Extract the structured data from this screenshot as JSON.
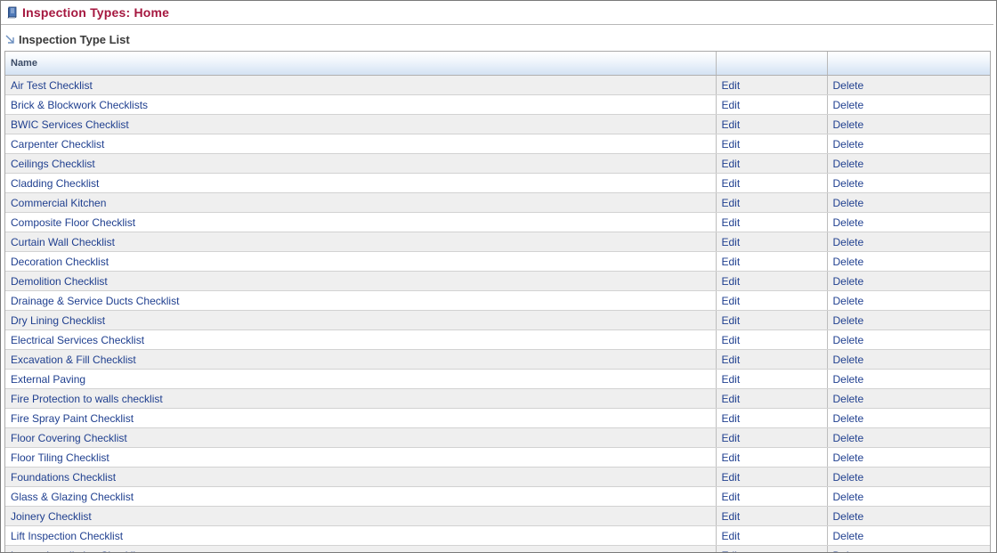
{
  "header": {
    "title": "Inspection Types: Home"
  },
  "section": {
    "title": "Inspection Type List"
  },
  "table": {
    "columns": [
      "Name",
      "",
      ""
    ],
    "edit_label": "Edit",
    "delete_label": "Delete",
    "rows": [
      "Air Test Checklist",
      "Brick & Blockwork Checklists",
      "BWIC Services Checklist",
      "Carpenter Checklist",
      "Ceilings Checklist",
      "Cladding Checklist",
      "Commercial Kitchen",
      "Composite Floor Checklist",
      "Curtain Wall Checklist",
      "Decoration Checklist",
      "Demolition Checklist",
      "Drainage & Service Ducts Checklist",
      "Dry Lining Checklist",
      "Electrical Services Checklist",
      "Excavation & Fill Checklist",
      "External Paving",
      "Fire Protection to walls checklist",
      "Fire Spray Paint Checklist",
      "Floor Covering Checklist",
      "Floor Tiling Checklist",
      "Foundations Checklist",
      "Glass & Glazing Checklist",
      "Joinery Checklist",
      "Lift Inspection Checklist",
      "Louvre Installation Checklist"
    ]
  },
  "colors": {
    "title": "#a5173f",
    "link": "#1f3f8f",
    "row_alt": "#efefef",
    "header_gradient_end": "#d3e2f3"
  },
  "icons": {
    "header": "book-icon",
    "section": "arrow-icon"
  }
}
